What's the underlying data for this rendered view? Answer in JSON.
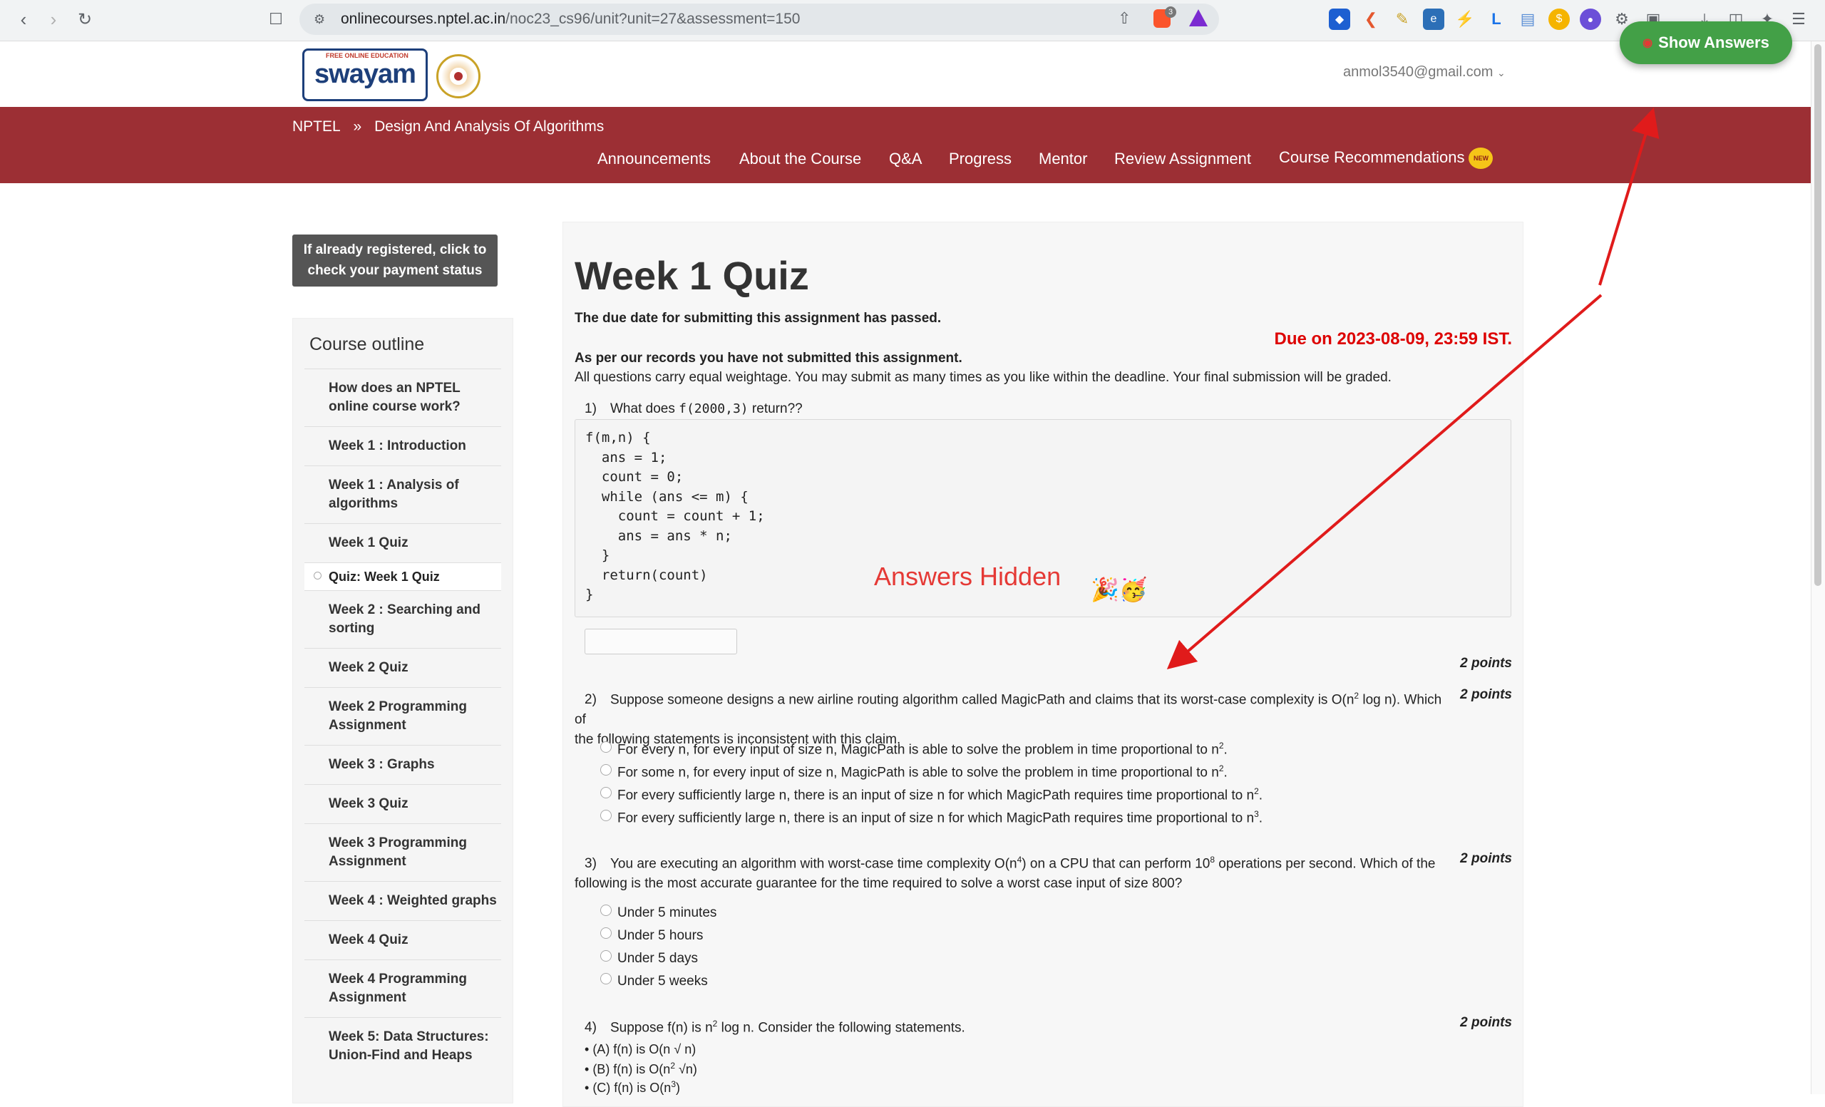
{
  "browser": {
    "url_host": "onlinecourses.nptel.ac.in",
    "url_path": "/noc23_cs96/unit?unit=27&assessment=150",
    "brave_badge": "3"
  },
  "header": {
    "logo_text": "swayam",
    "logo_top_text": "FREE ONLINE EDUCATION",
    "user_email": "anmol3540@gmail.com",
    "show_answers_label": "Show Answers"
  },
  "breadcrumb": {
    "root": "NPTEL",
    "separator": "»",
    "course": "Design And Analysis Of Algorithms"
  },
  "nav": {
    "items": [
      "Announcements",
      "About the Course",
      "Q&A",
      "Progress",
      "Mentor",
      "Review Assignment",
      "Course Recommendations"
    ],
    "new_badge": "NEW"
  },
  "sidebar": {
    "payment_button": "If already registered, click to check your payment status",
    "outline_title": "Course outline",
    "items": [
      "How does an NPTEL online course work?",
      "Week 1 : Introduction",
      "Week 1 : Analysis of algorithms",
      "Week 1 Quiz",
      "Quiz: Week 1 Quiz",
      "Week 2 : Searching and sorting",
      "Week 2 Quiz",
      "Week 2 Programming Assignment",
      "Week 3 : Graphs",
      "Week 3 Quiz",
      "Week 3 Programming Assignment",
      "Week 4 : Weighted graphs",
      "Week 4 Quiz",
      "Week 4 Programming Assignment",
      "Week 5: Data Structures: Union-Find and Heaps"
    ]
  },
  "main": {
    "title": "Week 1 Quiz",
    "due_passed": "The due date for submitting this assignment has passed.",
    "due_on": "Due on 2023-08-09, 23:59 IST.",
    "not_submitted": "As per our records you have not submitted this assignment.",
    "weightage": "All questions carry equal weightage. You may submit as many times as you like within the deadline. Your final submission will be graded.",
    "answers_hidden": "Answers Hidden",
    "questions": [
      {
        "num": "1)",
        "prompt_prefix": "What does ",
        "prompt_code": "f(2000,3)",
        "prompt_suffix": " return??",
        "code": "f(m,n) {\n  ans = 1;\n  count = 0;\n  while (ans <= m) {\n    count = count + 1;\n    ans = ans * n;\n  }\n  return(count)\n}",
        "points": "2 points"
      },
      {
        "num": "2)",
        "points": "2 points",
        "prompt_a": "Suppose someone designs a new airline routing algorithm called MagicPath and claims that its worst-case complexity is O(n",
        "prompt_sup": "2",
        "prompt_b": " log n). Which of",
        "prompt_line2": "the following statements is inconsistent with this claim.",
        "options": [
          {
            "text": "For every n, for every input of size n, MagicPath is able to solve the problem in time proportional to n",
            "sup": "2",
            "end": "."
          },
          {
            "text": "For some n, for every input of size n, MagicPath is able to solve the problem in time proportional to n",
            "sup": "2",
            "end": "."
          },
          {
            "text": "For every sufficiently large n, there is an input of size n for which MagicPath requires time proportional to n",
            "sup": "2",
            "end": "."
          },
          {
            "text": "For every sufficiently large n, there is an input of size n for which MagicPath requires time proportional to n",
            "sup": "3",
            "end": "."
          }
        ]
      },
      {
        "num": "3)",
        "points": "2 points",
        "prompt_a": "You are executing an algorithm with worst-case time complexity O(n",
        "prompt_sup1": "4",
        "prompt_b": ") on a CPU that can perform 10",
        "prompt_sup2": "8",
        "prompt_c": " operations per second. Which of the",
        "prompt_line2": "following is the most accurate guarantee for the time required to solve a worst case input of size 800?",
        "options": [
          "Under 5 minutes",
          "Under 5 hours",
          "Under 5 days",
          "Under 5 weeks"
        ]
      },
      {
        "num": "4)",
        "points": "2 points",
        "prompt_a": "Suppose f(n) is n",
        "prompt_sup": "2",
        "prompt_b": " log n. Consider the following statements.",
        "statements": [
          {
            "a": "(A) f(n) is O(n ",
            "b": "√",
            "c": " n)"
          },
          {
            "a": "(B) f(n) is O(n",
            "sup": "2",
            "c": " √n)"
          },
          {
            "a": "(C) f(n) is O(n",
            "sup": "3",
            "c": ")"
          }
        ]
      }
    ]
  }
}
